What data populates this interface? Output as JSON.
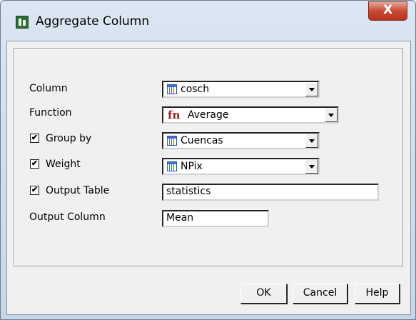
{
  "window": {
    "title": "Aggregate Column",
    "close_glyph": "X"
  },
  "form": {
    "column": {
      "label": "Column",
      "value": "cosch",
      "icon": "column-icon"
    },
    "function": {
      "label": "Function",
      "value": "Average",
      "icon_text": "fn"
    },
    "group_by": {
      "label": "Group by",
      "checked": true,
      "value": "Cuencas",
      "icon": "column-icon"
    },
    "weight": {
      "label": "Weight",
      "checked": true,
      "value": "NPix",
      "icon": "column-icon"
    },
    "output_table": {
      "label": "Output Table",
      "checked": true,
      "value": "statistics"
    },
    "output_column": {
      "label": "Output Column",
      "value": "Mean"
    }
  },
  "buttons": {
    "ok": "OK",
    "cancel": "Cancel",
    "help": "Help"
  },
  "check_glyph": "✔"
}
